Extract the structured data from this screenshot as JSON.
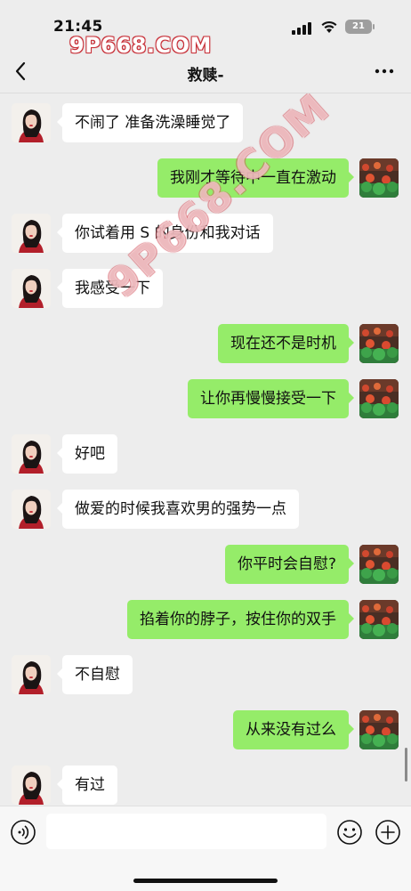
{
  "status_bar": {
    "time": "21:45",
    "battery": "21",
    "watermark": "9P668.COM"
  },
  "nav": {
    "title": "救赎-",
    "back_icon": "chevron-left",
    "more_icon": "ellipsis"
  },
  "watermark_diagonal": "9P668.COM",
  "messages": [
    {
      "side": "left",
      "text": "不闹了 准备洗澡睡觉了"
    },
    {
      "side": "right",
      "text": "我刚才等待中一直在激动"
    },
    {
      "side": "left",
      "text": "你试着用 S 的身份和我对话"
    },
    {
      "side": "left",
      "text": "我感受一下"
    },
    {
      "side": "right",
      "text": "现在还不是时机"
    },
    {
      "side": "right",
      "text": "让你再慢慢接受一下"
    },
    {
      "side": "left",
      "text": "好吧"
    },
    {
      "side": "left",
      "text": "做爱的时候我喜欢男的强势一点"
    },
    {
      "side": "right",
      "text": "你平时会自慰?"
    },
    {
      "side": "right",
      "text": "掐着你的脖子，按住你的双手"
    },
    {
      "side": "left",
      "text": "不自慰"
    },
    {
      "side": "right",
      "text": "从来没有过么"
    },
    {
      "side": "left",
      "text": "有过"
    }
  ],
  "input_bar": {
    "value": "",
    "placeholder": "",
    "voice_icon": "voice",
    "emoji_icon": "smiley",
    "plus_icon": "plus-circle"
  },
  "colors": {
    "background": "#ededed",
    "bubble_self": "#95ec69",
    "bubble_other": "#ffffff"
  }
}
